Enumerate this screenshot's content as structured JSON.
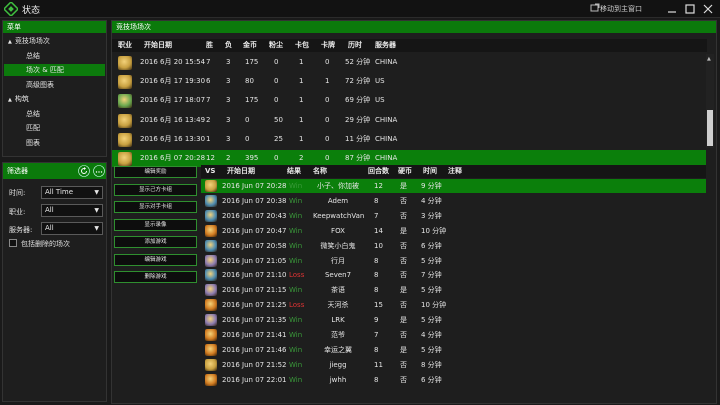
{
  "window": {
    "title": "状态",
    "move_to_main": "移动到主窗口"
  },
  "menu": {
    "header": "菜单",
    "items": [
      {
        "label": "竞技场场次",
        "level": 0,
        "expander": "▲"
      },
      {
        "label": "总结",
        "level": 1
      },
      {
        "label": "场次 & 匹配",
        "level": 1,
        "selected": true
      },
      {
        "label": "高级图表",
        "level": 1
      },
      {
        "label": "构筑",
        "level": 0,
        "expander": "▲"
      },
      {
        "label": "总结",
        "level": 1
      },
      {
        "label": "匹配",
        "level": 1
      },
      {
        "label": "图表",
        "level": 1
      }
    ]
  },
  "filters": {
    "header": "筛选器",
    "time_label": "时间:",
    "time_value": "All Time",
    "class_label": "职业:",
    "class_value": "All",
    "server_label": "服务器:",
    "server_value": "All",
    "include_deleted": "包括删除的场次"
  },
  "runs": {
    "header": "竞技场场次",
    "columns": [
      "职业",
      "开始日期",
      "胜",
      "负",
      "金币",
      "粉尘",
      "卡包",
      "卡牌",
      "历时",
      "服务器"
    ],
    "rows": [
      {
        "hero_color": "#c8a040",
        "date": "2016 6月 20 15:54",
        "wins": "7",
        "losses": "3",
        "gold": "175",
        "dust": "0",
        "packs": "1",
        "cards": "0",
        "duration": "52 分钟",
        "server": "CHINA"
      },
      {
        "hero_color": "#c8a040",
        "date": "2016 6月 17 19:30",
        "wins": "6",
        "losses": "3",
        "gold": "80",
        "dust": "0",
        "packs": "1",
        "cards": "1",
        "duration": "72 分钟",
        "server": "US"
      },
      {
        "hero_color": "#6aa84f",
        "date": "2016 6月 17 18:07",
        "wins": "7",
        "losses": "3",
        "gold": "175",
        "dust": "0",
        "packs": "1",
        "cards": "0",
        "duration": "69 分钟",
        "server": "US"
      },
      {
        "hero_color": "#c8a040",
        "date": "2016 6月 16 13:49",
        "wins": "2",
        "losses": "3",
        "gold": "0",
        "dust": "50",
        "packs": "1",
        "cards": "0",
        "duration": "29 分钟",
        "server": "CHINA"
      },
      {
        "hero_color": "#c8a040",
        "date": "2016 6月 16 13:30",
        "wins": "1",
        "losses": "3",
        "gold": "0",
        "dust": "25",
        "packs": "1",
        "cards": "0",
        "duration": "11 分钟",
        "server": "CHINA"
      },
      {
        "hero_color": "#c8a040",
        "date": "2016 6月 07 20:28",
        "wins": "12",
        "losses": "2",
        "gold": "395",
        "dust": "0",
        "packs": "2",
        "cards": "0",
        "duration": "87 分钟",
        "server": "CHINA",
        "selected": true
      }
    ]
  },
  "actions": [
    "编辑奖励",
    "显示己方卡组",
    "显示对手卡组",
    "显示录像",
    "添加游戏",
    "编辑游戏",
    "删除游戏"
  ],
  "games": {
    "columns": [
      "VS",
      "开始日期",
      "结果",
      "名称",
      "回合数",
      "硬币",
      "时间",
      "注释"
    ],
    "rows": [
      {
        "hero_color": "#c8a040",
        "date": "2016 Jun 07 20:28",
        "result": "Win",
        "name": "小子、你加被",
        "turns": "12",
        "coin": "是",
        "time": "9 分钟",
        "selected": true
      },
      {
        "hero_color": "#4a8ab0",
        "date": "2016 Jun 07 20:38",
        "result": "Win",
        "name": "Adem",
        "turns": "8",
        "coin": "否",
        "time": "4 分钟"
      },
      {
        "hero_color": "#4a8ab0",
        "date": "2016 Jun 07 20:43",
        "result": "Win",
        "name": "KeepwatchVan",
        "turns": "7",
        "coin": "否",
        "time": "3 分钟"
      },
      {
        "hero_color": "#d07a20",
        "date": "2016 Jun 07 20:47",
        "result": "Win",
        "name": "FOX",
        "turns": "14",
        "coin": "是",
        "time": "10 分钟"
      },
      {
        "hero_color": "#4a8ab0",
        "date": "2016 Jun 07 20:58",
        "result": "Win",
        "name": "微笑小白鬼",
        "turns": "10",
        "coin": "否",
        "time": "6 分钟"
      },
      {
        "hero_color": "#8a7ab0",
        "date": "2016 Jun 07 21:05",
        "result": "Win",
        "name": "行月",
        "turns": "8",
        "coin": "否",
        "time": "5 分钟"
      },
      {
        "hero_color": "#4a8ab0",
        "date": "2016 Jun 07 21:10",
        "result": "Loss",
        "name": "Seven7",
        "turns": "8",
        "coin": "否",
        "time": "7 分钟"
      },
      {
        "hero_color": "#8a7ab0",
        "date": "2016 Jun 07 21:15",
        "result": "Win",
        "name": "茶语",
        "turns": "8",
        "coin": "是",
        "time": "5 分钟"
      },
      {
        "hero_color": "#d07a20",
        "date": "2016 Jun 07 21:25",
        "result": "Loss",
        "name": "天河杀",
        "turns": "15",
        "coin": "否",
        "time": "10 分钟"
      },
      {
        "hero_color": "#8a7ab0",
        "date": "2016 Jun 07 21:35",
        "result": "Win",
        "name": "LRK",
        "turns": "9",
        "coin": "是",
        "time": "5 分钟"
      },
      {
        "hero_color": "#d07a20",
        "date": "2016 Jun 07 21:41",
        "result": "Win",
        "name": "范爷",
        "turns": "7",
        "coin": "否",
        "time": "4 分钟"
      },
      {
        "hero_color": "#d07a20",
        "date": "2016 Jun 07 21:46",
        "result": "Win",
        "name": "幸运之翼",
        "turns": "8",
        "coin": "是",
        "time": "5 分钟"
      },
      {
        "hero_color": "#c8a040",
        "date": "2016 Jun 07 21:52",
        "result": "Win",
        "name": "jiegg",
        "turns": "11",
        "coin": "否",
        "time": "8 分钟"
      },
      {
        "hero_color": "#d07a20",
        "date": "2016 Jun 07 22:01",
        "result": "Win",
        "name": "jwhh",
        "turns": "8",
        "coin": "否",
        "time": "6 分钟"
      }
    ]
  },
  "colors": {
    "accent": "#0b7a0b",
    "win": "#3a9a3a",
    "loss": "#dd3333"
  },
  "icons": [
    "app-logo-icon",
    "move-window-icon",
    "minimize-icon",
    "maximize-icon",
    "close-icon",
    "refresh-icon",
    "more-icon"
  ]
}
